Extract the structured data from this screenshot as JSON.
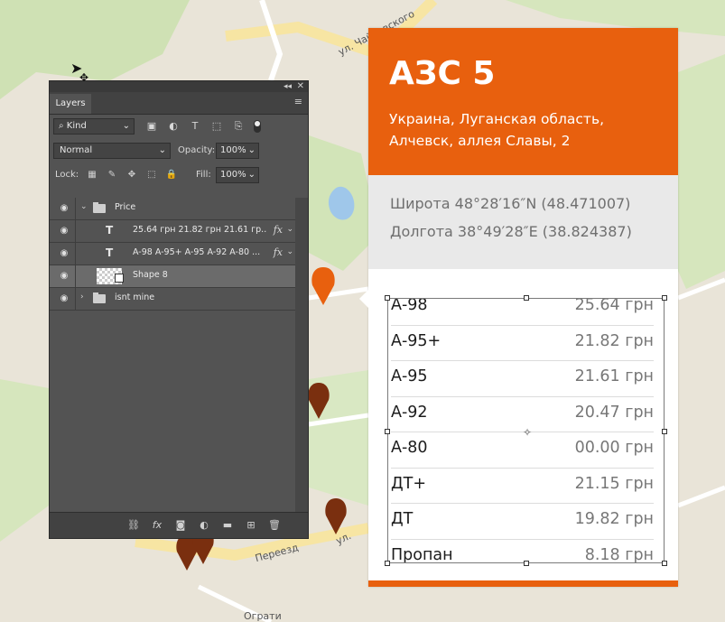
{
  "map": {
    "street_labels": [
      "ул. Чайковского",
      "ул.",
      "Переезд",
      "Ограти"
    ],
    "colors": {
      "base": "#e9e4d8",
      "road_major": "#f7e5a3",
      "road_minor": "#ffffff",
      "park": "#cfe1b4",
      "water": "#9fc7ea",
      "pin_selected": "#e8600e",
      "pin": "#7a2f0f"
    }
  },
  "layers_panel": {
    "tab_label": "Layers",
    "filter_kind": "Kind",
    "blend_mode": "Normal",
    "opacity_label": "Opacity:",
    "opacity_value": "100%",
    "lock_label": "Lock:",
    "fill_label": "Fill:",
    "fill_value": "100%",
    "layers": [
      {
        "name": "Price",
        "type": "group",
        "expanded": true
      },
      {
        "name": "25.64 грн 21.82 грн   21.61 гр...",
        "type": "text",
        "fx": "fx"
      },
      {
        "name": "A-98 A-95+   A-95   A-92 A-80 ...",
        "type": "text",
        "fx": "fx"
      },
      {
        "name": "Shape 8",
        "type": "shape",
        "selected": true
      },
      {
        "name": "isnt mine",
        "type": "group",
        "expanded": false
      }
    ]
  },
  "station": {
    "title": "АЗС 5",
    "address_line1": "Украина, Луганская область,",
    "address_line2": "Алчевск, аллея Славы, 2",
    "latitude": "Широта  48°28′16″N (48.471007)",
    "longitude": "Долгота 38°49′28″E (38.824387)",
    "prices": [
      {
        "fuel": "А-98",
        "price": "25.64 грн"
      },
      {
        "fuel": "А-95+",
        "price": "21.82 грн"
      },
      {
        "fuel": "А-95",
        "price": "21.61 грн"
      },
      {
        "fuel": "А-92",
        "price": "20.47 грн"
      },
      {
        "fuel": "А-80",
        "price": "00.00 грн"
      },
      {
        "fuel": "ДТ+",
        "price": "21.15 грн"
      },
      {
        "fuel": "ДТ",
        "price": "19.82 грн"
      },
      {
        "fuel": "Пропан",
        "price": "8.18 грн"
      }
    ],
    "accent_color": "#e8600e"
  }
}
